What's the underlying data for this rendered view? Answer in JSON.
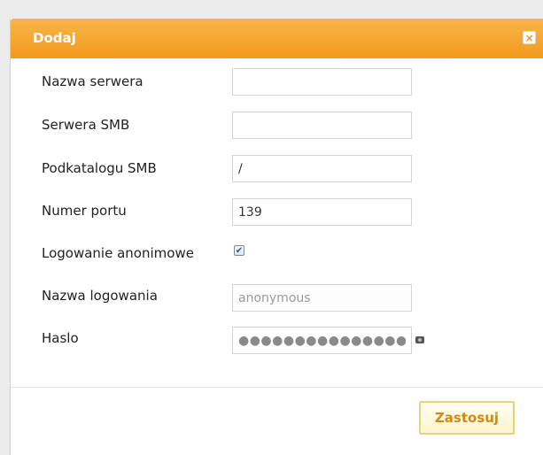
{
  "dialog": {
    "title": "Dodaj",
    "close_glyph": "×"
  },
  "fields": [
    {
      "label": "Nazwa serwera",
      "value": ""
    },
    {
      "label": "Serwera SMB",
      "value": ""
    },
    {
      "label": "Podkatalogu SMB",
      "value": "/"
    },
    {
      "label": "Numer portu",
      "value": "139"
    },
    {
      "label": "Logowanie anonimowe",
      "checked": true,
      "check_glyph": "✔"
    },
    {
      "label": "Nazwa logowania",
      "value": "anonymous"
    },
    {
      "label": "Haslo",
      "value": "●●●●●●●●●●●●●●●●●"
    }
  ],
  "actions": {
    "apply_label": "Zastosuj"
  },
  "colors": {
    "title_bar": "#f29a1c",
    "apply_text": "#d08a14"
  },
  "icons": {
    "close": "close-icon",
    "show_password": "eye-icon"
  }
}
